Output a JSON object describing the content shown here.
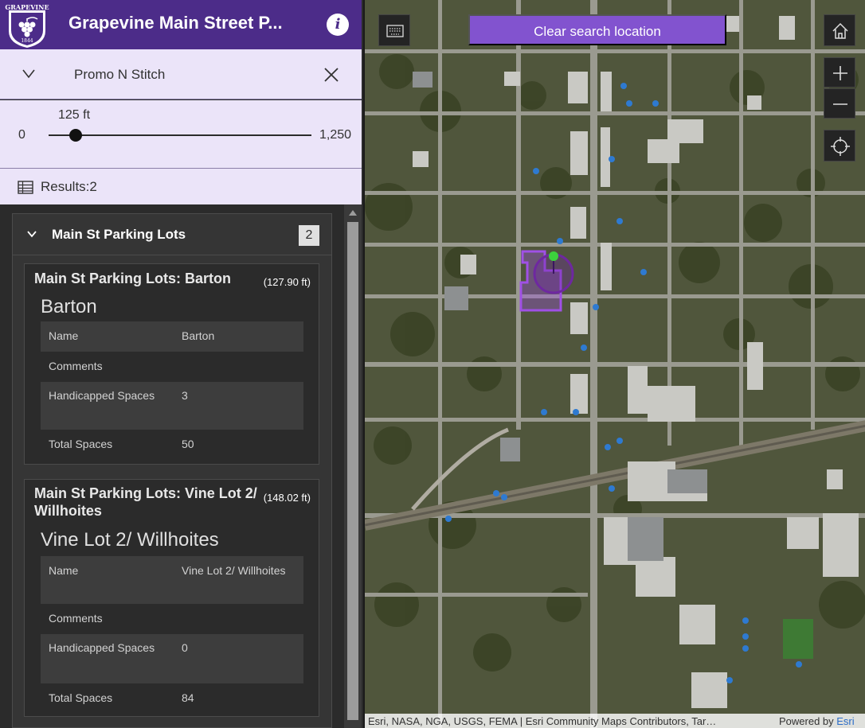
{
  "header": {
    "title": "Grapevine Main Street P...",
    "logo_text": "GRAPEVINE",
    "logo_year": "1844",
    "brand_color": "#4c2c89",
    "info_icon": "info-icon"
  },
  "search": {
    "value": "Promo N Stitch",
    "collapse_icon": "chevron-down-icon",
    "clear_icon": "close-icon"
  },
  "buffer_slider": {
    "current_label": "125 ft",
    "min_label": "0",
    "max_label": "1,250",
    "value": 125,
    "min": 0,
    "max": 1250
  },
  "results": {
    "label": "Results:2",
    "icon": "table-icon"
  },
  "group": {
    "title": "Main St Parking Lots",
    "count": "2",
    "cards": [
      {
        "title": "Main St Parking Lots: Barton",
        "distance": "(127.90 ft)",
        "subtitle": "Barton",
        "attributes": [
          {
            "key": "Name",
            "value": "Barton"
          },
          {
            "key": "Comments",
            "value": ""
          },
          {
            "key": "Handicapped Spaces",
            "value": "3"
          },
          {
            "key": "Total Spaces",
            "value": "50"
          }
        ]
      },
      {
        "title": "Main St Parking Lots: Vine Lot 2/ Willhoites",
        "distance": "(148.02 ft)",
        "subtitle": "Vine Lot 2/ Willhoites",
        "attributes": [
          {
            "key": "Name",
            "value": "Vine Lot 2/ Willhoites"
          },
          {
            "key": "Comments",
            "value": ""
          },
          {
            "key": "Handicapped Spaces",
            "value": "0"
          },
          {
            "key": "Total Spaces",
            "value": "84"
          }
        ]
      }
    ]
  },
  "map": {
    "clear_search_label": "Clear search location",
    "attribution": "Esri, NASA, NGA, USGS, FEMA | Esri Community Maps Contributors, Tar…",
    "powered_by": "Powered by ",
    "powered_link": "Esri",
    "accent_color": "#8253cf",
    "buttons": [
      "keyboard-icon",
      "home-icon",
      "zoom-in-icon",
      "zoom-out-icon",
      "locate-icon"
    ]
  }
}
